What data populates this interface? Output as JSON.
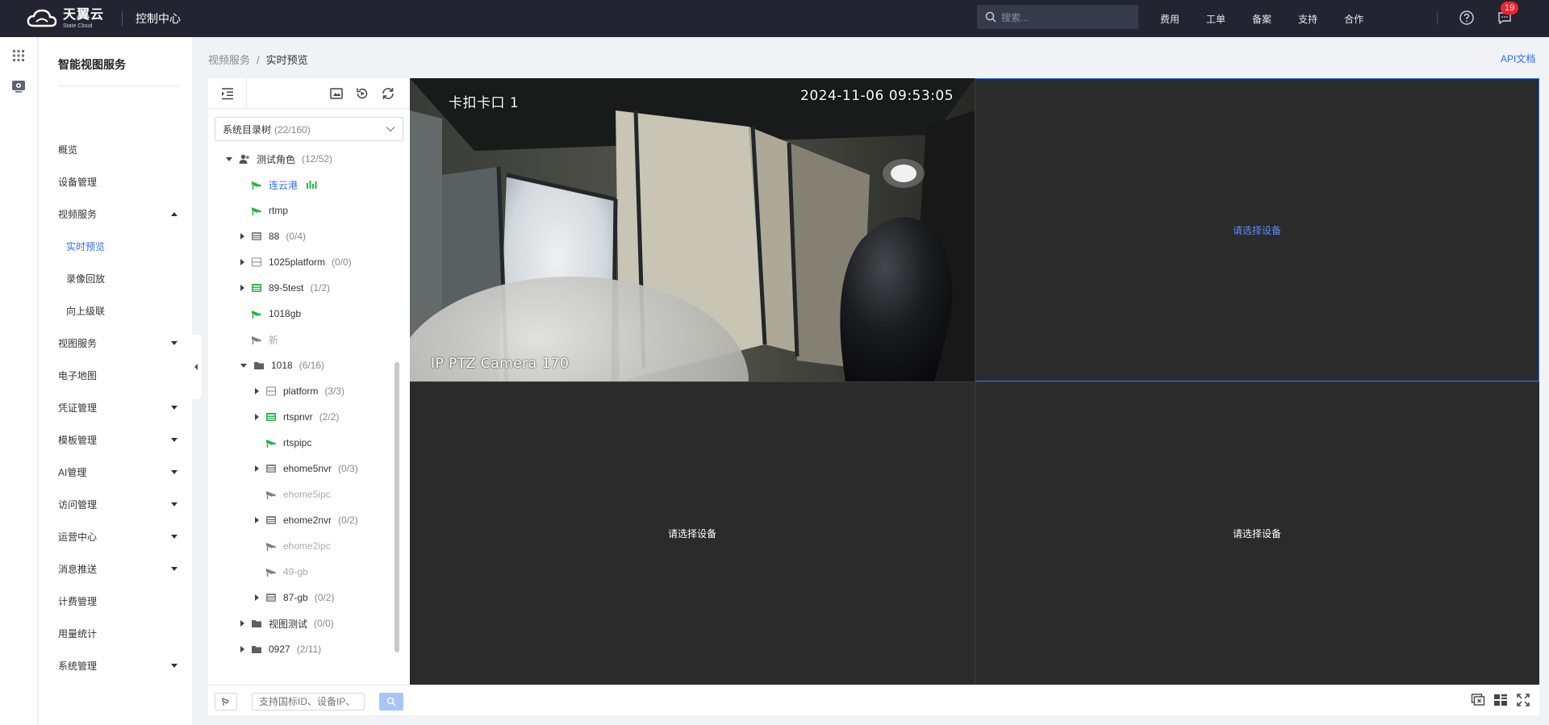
{
  "header": {
    "logo_cn": "天翼云",
    "logo_en": "State Cloud",
    "console_title": "控制中心",
    "search_placeholder": "搜索...",
    "menu": [
      "费用",
      "工单",
      "备案",
      "支持",
      "合作"
    ],
    "notification_count": "19"
  },
  "nav": {
    "title": "智能视图服务",
    "items": [
      {
        "label": "概览",
        "caret": ""
      },
      {
        "label": "设备管理",
        "caret": ""
      },
      {
        "label": "视频服务",
        "caret": "up"
      },
      {
        "label": "实时预览",
        "sub": true,
        "active": true
      },
      {
        "label": "录像回放",
        "sub": true
      },
      {
        "label": "向上级联",
        "sub": true
      },
      {
        "label": "视图服务",
        "caret": "down"
      },
      {
        "label": "电子地图",
        "caret": ""
      },
      {
        "label": "凭证管理",
        "caret": "down"
      },
      {
        "label": "模板管理",
        "caret": "down"
      },
      {
        "label": "AI管理",
        "caret": "down"
      },
      {
        "label": "访问管理",
        "caret": "down"
      },
      {
        "label": "运营中心",
        "caret": "down"
      },
      {
        "label": "消息推送",
        "caret": "down"
      },
      {
        "label": "计费管理",
        "caret": ""
      },
      {
        "label": "用量统计",
        "caret": ""
      },
      {
        "label": "系统管理",
        "caret": "down"
      }
    ]
  },
  "breadcrumb": {
    "parent": "视频服务",
    "separator": "/",
    "current": "实时预览"
  },
  "api_doc_label": "API文档",
  "tree": {
    "selector_label": "系统目录树",
    "selector_count": "(22/160)",
    "search_placeholder": "支持国标ID、设备IP、",
    "rows": [
      {
        "label": "测试角色",
        "count": "(12/52)",
        "indent": 0,
        "toggle": "down",
        "icon": "user",
        "state": "online"
      },
      {
        "label": "连云港",
        "count": "",
        "indent": 1,
        "toggle": "",
        "icon": "camera-green",
        "state": "active",
        "playing": true
      },
      {
        "label": "rtmp",
        "count": "",
        "indent": 1,
        "toggle": "",
        "icon": "camera-green",
        "state": "online"
      },
      {
        "label": "88",
        "count": "(0/4)",
        "indent": 1,
        "toggle": "right",
        "icon": "nvr-gray",
        "state": "online"
      },
      {
        "label": "1025platform",
        "count": "(0/0)",
        "indent": 1,
        "toggle": "right",
        "icon": "platform",
        "state": "online"
      },
      {
        "label": "89-5test",
        "count": "(1/2)",
        "indent": 1,
        "toggle": "right",
        "icon": "nvr-green",
        "state": "online"
      },
      {
        "label": "1018gb",
        "count": "",
        "indent": 1,
        "toggle": "",
        "icon": "camera-green",
        "state": "online"
      },
      {
        "label": "新",
        "count": "",
        "indent": 1,
        "toggle": "",
        "icon": "camera-gray",
        "state": "offline"
      },
      {
        "label": "1018",
        "count": "(6/16)",
        "indent": 1,
        "toggle": "down",
        "icon": "folder",
        "state": "online"
      },
      {
        "label": "platform",
        "count": "(3/3)",
        "indent": 2,
        "toggle": "right",
        "icon": "platform",
        "state": "online"
      },
      {
        "label": "rtspnvr",
        "count": "(2/2)",
        "indent": 2,
        "toggle": "right",
        "icon": "nvr-green",
        "state": "online"
      },
      {
        "label": "rtspipc",
        "count": "",
        "indent": 2,
        "toggle": "",
        "icon": "camera-green",
        "state": "online"
      },
      {
        "label": "ehome5nvr",
        "count": "(0/3)",
        "indent": 2,
        "toggle": "right",
        "icon": "nvr-gray",
        "state": "online"
      },
      {
        "label": "ehome5ipc",
        "count": "",
        "indent": 2,
        "toggle": "",
        "icon": "camera-gray",
        "state": "offline"
      },
      {
        "label": "ehome2nvr",
        "count": "(0/2)",
        "indent": 2,
        "toggle": "right",
        "icon": "nvr-gray",
        "state": "online"
      },
      {
        "label": "ehome2ipc",
        "count": "",
        "indent": 2,
        "toggle": "",
        "icon": "camera-gray",
        "state": "offline"
      },
      {
        "label": "49-gb",
        "count": "",
        "indent": 2,
        "toggle": "",
        "icon": "camera-gray",
        "state": "offline"
      },
      {
        "label": "87-gb",
        "count": "(0/2)",
        "indent": 2,
        "toggle": "right",
        "icon": "nvr-gray",
        "state": "online"
      },
      {
        "label": "视图测试",
        "count": "(0/0)",
        "indent": 1,
        "toggle": "right",
        "icon": "folder",
        "state": "online"
      },
      {
        "label": "0927",
        "count": "(2/11)",
        "indent": 1,
        "toggle": "right",
        "icon": "folder",
        "state": "online"
      }
    ]
  },
  "video": {
    "cells": [
      {
        "type": "stream",
        "osd_name": "卡扣卡口 1",
        "osd_time": "2024-11-06 09:53:05",
        "osd_camera": "IP PTZ Camera 170"
      },
      {
        "type": "empty",
        "message": "请选择设备",
        "selected": true
      },
      {
        "type": "empty",
        "message": "请选择设备"
      },
      {
        "type": "empty",
        "message": "请选择设备"
      }
    ]
  },
  "colors": {
    "accent": "#2f6ef5",
    "topbar": "#222531",
    "online_green": "#2bb24c",
    "badge": "#f5222d"
  }
}
